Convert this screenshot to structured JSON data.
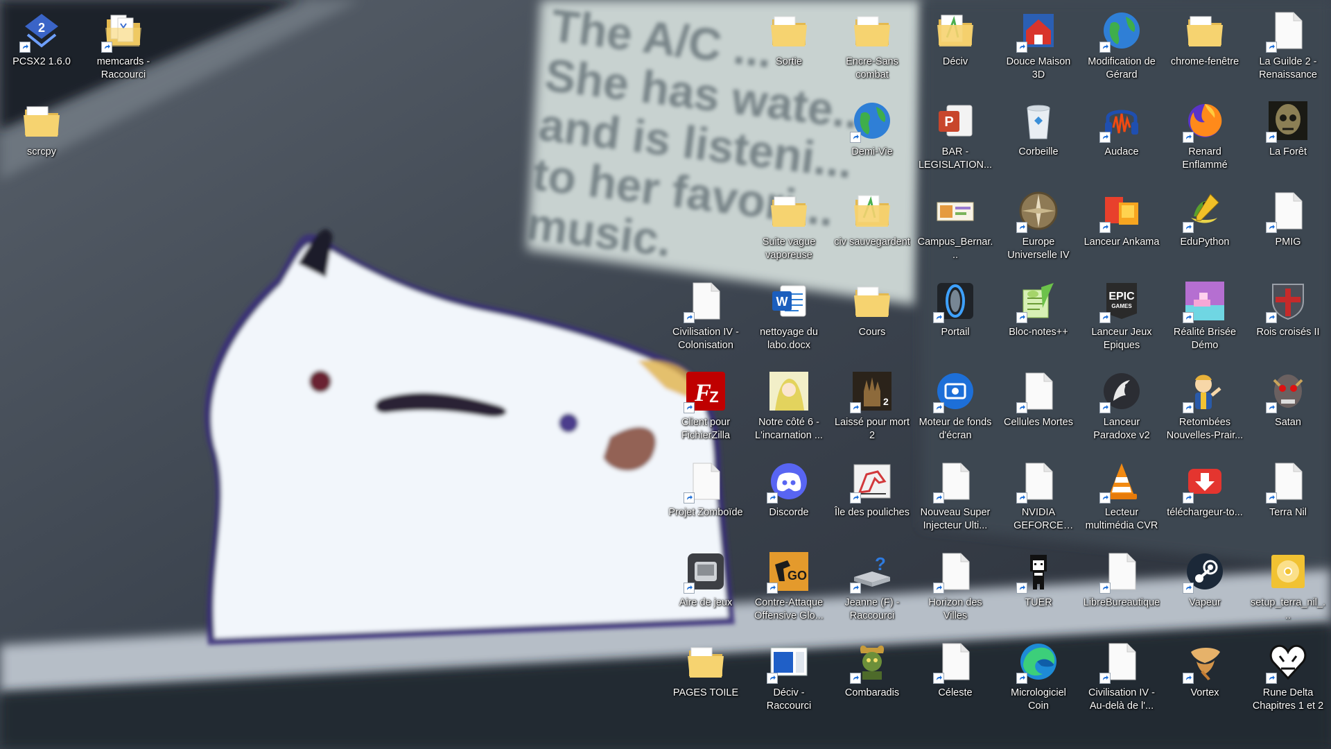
{
  "desktop": {
    "icons": [
      {
        "label": "PCSX2 1.6.0",
        "icon": "pcsx2-icon",
        "kind": "pcsx2",
        "shortcut": true
      },
      {
        "label": "memcards - Raccourci",
        "icon": "folder-files-icon",
        "kind": "memcards",
        "shortcut": true
      },
      {
        "label": "scrcpy",
        "icon": "folder-icon",
        "kind": "folder",
        "shortcut": false
      },
      {
        "label": "Sortie",
        "icon": "folder-icon",
        "kind": "folder",
        "shortcut": false
      },
      {
        "label": "Encre-Sans combat",
        "icon": "folder-icon",
        "kind": "folder",
        "shortcut": false
      },
      {
        "label": "Déciv",
        "icon": "folder-icon",
        "kind": "folder-green",
        "shortcut": false
      },
      {
        "label": "Douce Maison 3D",
        "icon": "sweet-home-icon",
        "kind": "house",
        "shortcut": true
      },
      {
        "label": "Modification de Gérard",
        "icon": "globe-icon",
        "kind": "globe",
        "shortcut": true
      },
      {
        "label": "chrome-fenêtre",
        "icon": "folder-icon",
        "kind": "folder",
        "shortcut": false
      },
      {
        "label": "La Guilde 2 - Renaissance",
        "icon": "file-icon",
        "kind": "file",
        "shortcut": true
      },
      {
        "label": "Demi-Vie",
        "icon": "globe-icon",
        "kind": "globe",
        "shortcut": true
      },
      {
        "label": "BAR - LEGISLATION...",
        "icon": "powerpoint-icon",
        "kind": "ppt",
        "shortcut": false
      },
      {
        "label": "Corbeille",
        "icon": "recycle-bin-icon",
        "kind": "bin",
        "shortcut": false
      },
      {
        "label": "Audace",
        "icon": "audacity-icon",
        "kind": "audacity",
        "shortcut": true
      },
      {
        "label": "Renard Enflammé",
        "icon": "firefox-icon",
        "kind": "firefox",
        "shortcut": true
      },
      {
        "label": "La Forêt",
        "icon": "skull-forest-icon",
        "kind": "forest",
        "shortcut": true
      },
      {
        "label": "Suite vague vaporeuse",
        "icon": "folder-icon",
        "kind": "folder",
        "shortcut": false
      },
      {
        "label": "civ sauvegardent",
        "icon": "folder-icon",
        "kind": "folder-green",
        "shortcut": false
      },
      {
        "label": "Campus_Bernar...",
        "icon": "image-file-icon",
        "kind": "image",
        "shortcut": false
      },
      {
        "label": "Europe Universelle IV",
        "icon": "compass-icon",
        "kind": "compass",
        "shortcut": true
      },
      {
        "label": "Lanceur Ankama",
        "icon": "ankama-icon",
        "kind": "ankama",
        "shortcut": true
      },
      {
        "label": "EduPython",
        "icon": "python-icon",
        "kind": "python",
        "shortcut": true
      },
      {
        "label": "PMIG",
        "icon": "file-icon",
        "kind": "file",
        "shortcut": true
      },
      {
        "label": "Civilisation IV - Colonisation",
        "icon": "file-icon",
        "kind": "file",
        "shortcut": true
      },
      {
        "label": "nettoyage du labo.docx",
        "icon": "word-icon",
        "kind": "word",
        "shortcut": false
      },
      {
        "label": "Cours",
        "icon": "folder-icon",
        "kind": "folder",
        "shortcut": false
      },
      {
        "label": "Portail",
        "icon": "portal-icon",
        "kind": "portal",
        "shortcut": true
      },
      {
        "label": "Bloc-notes++",
        "icon": "notepad-plus-icon",
        "kind": "notepad",
        "shortcut": true
      },
      {
        "label": "Lanceur Jeux Epiques",
        "icon": "epic-games-icon",
        "kind": "epic",
        "shortcut": true
      },
      {
        "label": "Réalité Brisée Démo",
        "icon": "broken-reality-icon",
        "kind": "broken",
        "shortcut": true
      },
      {
        "label": "Rois croisés II",
        "icon": "crusader-shield-icon",
        "kind": "crusader",
        "shortcut": true
      },
      {
        "label": "Client pour FichierZilla",
        "icon": "filezilla-icon",
        "kind": "filezilla",
        "shortcut": true
      },
      {
        "label": "Notre côté 6 - L'incarnation ...",
        "icon": "anime-image-icon",
        "kind": "anime",
        "shortcut": false
      },
      {
        "label": "Laissé pour mort 2",
        "icon": "left4dead-icon",
        "kind": "l4d",
        "shortcut": true
      },
      {
        "label": "Moteur de fonds d'écran",
        "icon": "wallpaper-engine-icon",
        "kind": "wallpaper",
        "shortcut": true
      },
      {
        "label": "Cellules Mortes",
        "icon": "file-icon",
        "kind": "file",
        "shortcut": true
      },
      {
        "label": "Lanceur Paradoxe v2",
        "icon": "paradox-icon",
        "kind": "paradox",
        "shortcut": true
      },
      {
        "label": "Retombées Nouvelles-Prair...",
        "icon": "vault-boy-icon",
        "kind": "vaultboy",
        "shortcut": true
      },
      {
        "label": "Satan",
        "icon": "demon-skull-icon",
        "kind": "demon",
        "shortcut": true
      },
      {
        "label": "Projet Zomboïde",
        "icon": "file-icon",
        "kind": "file",
        "shortcut": true
      },
      {
        "label": "Discorde",
        "icon": "discord-icon",
        "kind": "discord",
        "shortcut": true
      },
      {
        "label": "Île des pouliches",
        "icon": "horse-island-icon",
        "kind": "horse",
        "shortcut": true
      },
      {
        "label": "Nouveau Super Injecteur Ulti...",
        "icon": "file-icon",
        "kind": "file",
        "shortcut": true
      },
      {
        "label": "NVIDIA GEFORCE MAINTENANT",
        "icon": "file-icon",
        "kind": "file",
        "shortcut": true
      },
      {
        "label": "Lecteur multimédia CVR",
        "icon": "vlc-cone-icon",
        "kind": "vlc",
        "shortcut": true
      },
      {
        "label": "téléchargeur-to...",
        "icon": "download-icon",
        "kind": "download",
        "shortcut": true
      },
      {
        "label": "Terra Nil",
        "icon": "file-icon",
        "kind": "file",
        "shortcut": true
      },
      {
        "label": "Aire de jeux",
        "icon": "game-launcher-icon",
        "kind": "gamepad",
        "shortcut": true
      },
      {
        "label": "Contre-Attaque Offensive Glo...",
        "icon": "csgo-icon",
        "kind": "csgo",
        "shortcut": true
      },
      {
        "label": "Jeanne (F) - Raccourci",
        "icon": "drive-question-icon",
        "kind": "drive",
        "shortcut": true
      },
      {
        "label": "Horizon des Villes",
        "icon": "file-icon",
        "kind": "file",
        "shortcut": true
      },
      {
        "label": "TUER",
        "icon": "pixel-character-icon",
        "kind": "pixel",
        "shortcut": true
      },
      {
        "label": "LibreBureautique",
        "icon": "file-icon",
        "kind": "file",
        "shortcut": true
      },
      {
        "label": "Vapeur",
        "icon": "steam-icon",
        "kind": "steam",
        "shortcut": true
      },
      {
        "label": "setup_terra_nil_...",
        "icon": "disc-icon",
        "kind": "disc",
        "shortcut": false
      },
      {
        "label": "PAGES TOILE",
        "icon": "folder-icon",
        "kind": "folder",
        "shortcut": false
      },
      {
        "label": "Déciv - Raccourci",
        "icon": "blue-window-icon",
        "kind": "bluewin",
        "shortcut": true
      },
      {
        "label": "Combaradis",
        "icon": "warrior-icon",
        "kind": "warrior",
        "shortcut": true
      },
      {
        "label": "Céleste",
        "icon": "file-icon",
        "kind": "file",
        "shortcut": true
      },
      {
        "label": "Micrologiciel Coin",
        "icon": "edge-icon",
        "kind": "edge",
        "shortcut": true
      },
      {
        "label": "Civilisation IV - Au-delà de l'...",
        "icon": "file-icon",
        "kind": "file",
        "shortcut": true
      },
      {
        "label": "Vortex",
        "icon": "vortex-icon",
        "kind": "vortex",
        "shortcut": true
      },
      {
        "label": "Rune Delta Chapitres 1 et 2",
        "icon": "heart-icon",
        "kind": "heart",
        "shortcut": true
      }
    ]
  },
  "wallpaper": {
    "sign_lines": [
      "The A/C ...",
      "She has wate...",
      "and is listeni...",
      "to her favori...",
      "music."
    ]
  }
}
